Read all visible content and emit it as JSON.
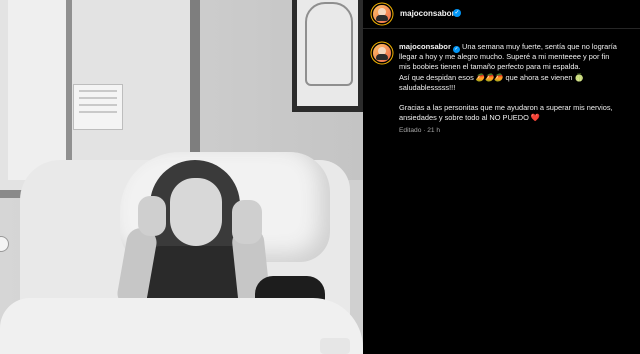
{
  "post": {
    "username": "majoconsabor",
    "verified_icon": "verified-badge-icon",
    "caption_lines": [
      "Una semana muy fuerte, sentía que no lograría",
      "llegar a hoy y me alegro mucho. Superé a mi menteeee y por fin",
      "mis boobies tienen el tamaño perfecto para mi espalda.",
      "Así que despidan esos 🥭🥭🥭 que ahora se vienen 🍈",
      "saludablesssss!!!",
      "Gracias a las personitas que me ayudaron a superar mis nervios,",
      "ansiedades y sobre todo al NO PUEDO ❤️"
    ],
    "meta_status": "Editado",
    "meta_separator": "·",
    "meta_time": "21 h"
  },
  "colors": {
    "background": "#000000",
    "text": "#f5f5f5",
    "muted": "#a8a8a8",
    "verified": "#0095f6",
    "heart": "#ed4956"
  }
}
